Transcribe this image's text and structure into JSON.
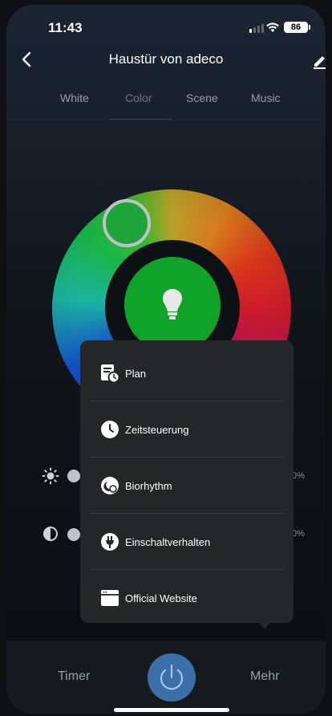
{
  "status_bar": {
    "time": "11:43",
    "battery": "86"
  },
  "header": {
    "title": "Haustür von adeco"
  },
  "tabs": [
    {
      "label": "White"
    },
    {
      "label": "Color"
    },
    {
      "label": "Scene"
    },
    {
      "label": "Music"
    }
  ],
  "active_tab": "Color",
  "sliders": [
    {
      "name": "brightness",
      "value_text": "0%"
    },
    {
      "name": "contrast",
      "value_text": "0%"
    }
  ],
  "menu": {
    "items": [
      {
        "label": "Plan",
        "icon": "schedule-icon"
      },
      {
        "label": "Zeitsteuerung",
        "icon": "clock-icon"
      },
      {
        "label": "Biorhythm",
        "icon": "biorhythm-icon"
      },
      {
        "label": "Einschaltverhalten",
        "icon": "plug-icon"
      },
      {
        "label": "Official Website",
        "icon": "browser-icon"
      }
    ]
  },
  "bottom_bar": {
    "timer_label": "Timer",
    "more_label": "Mehr"
  },
  "colors": {
    "selected_color": "#0fa32a",
    "power_button": "#3a6fa8",
    "menu_bg": "#252628"
  }
}
